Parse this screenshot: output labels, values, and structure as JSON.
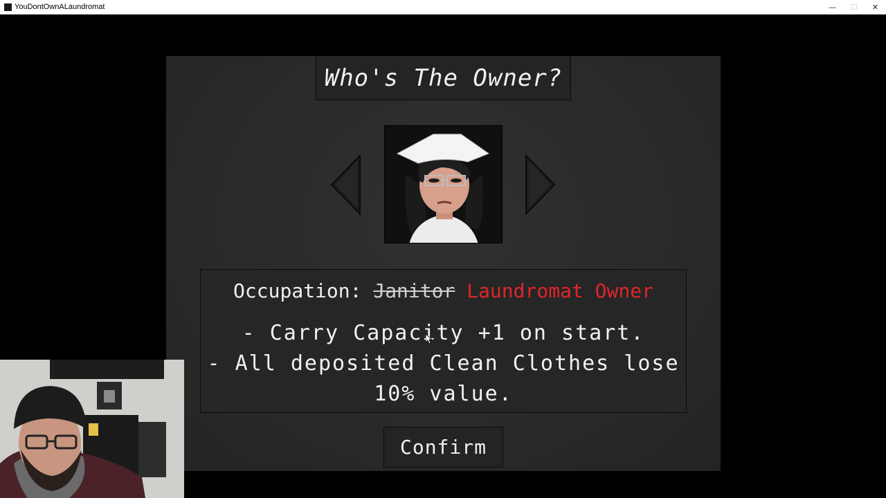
{
  "window": {
    "title": "YouDontOwnALaundromat",
    "minimize": "—",
    "maximize": "☐",
    "close": "✕"
  },
  "screen": {
    "title": "Who's The Owner?",
    "occupation_label": "Occupation:",
    "occupation_old": "Janitor",
    "occupation_new": "Laundromat Owner",
    "perks": [
      "- Carry Capacity +1 on start.",
      "- All deposited Clean Clothes lose 10% value."
    ],
    "confirm_label": "Confirm"
  },
  "colors": {
    "panel": "#2b2b2b",
    "box": "#242424",
    "text": "#f2f2f2",
    "occupation_new": "#e0252a"
  },
  "icons": {
    "prev": "arrow-left-icon",
    "next": "arrow-right-icon"
  }
}
